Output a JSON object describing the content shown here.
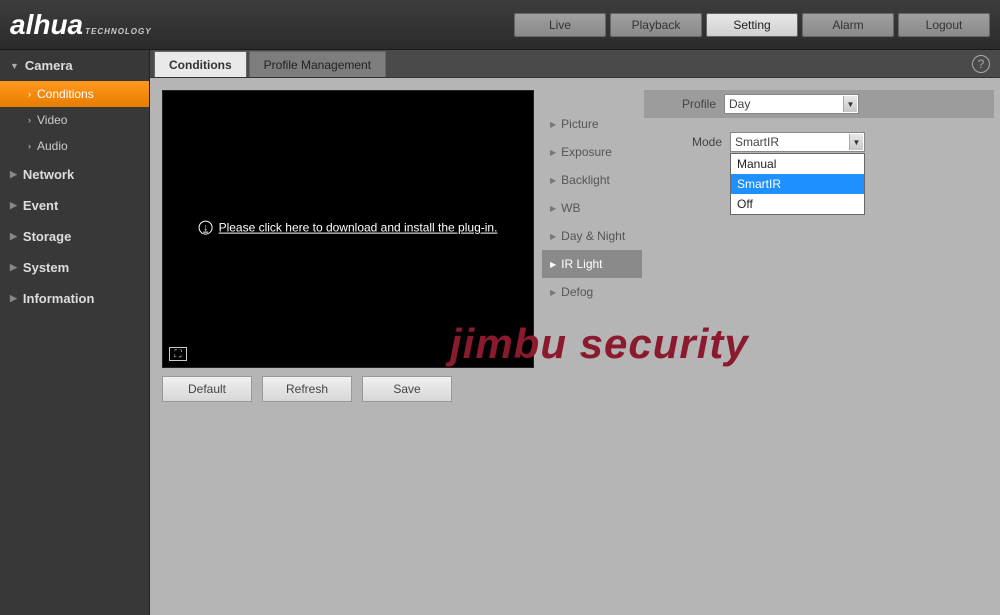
{
  "brand": {
    "name": "alhua",
    "sub": "TECHNOLOGY"
  },
  "top_tabs": {
    "live": "Live",
    "playback": "Playback",
    "setting": "Setting",
    "alarm": "Alarm",
    "logout": "Logout"
  },
  "sidebar": {
    "camera": {
      "label": "Camera",
      "items": {
        "conditions": "Conditions",
        "video": "Video",
        "audio": "Audio"
      }
    },
    "network": "Network",
    "event": "Event",
    "storage": "Storage",
    "system": "System",
    "information": "Information"
  },
  "sub_tabs": {
    "conditions": "Conditions",
    "profile_mgmt": "Profile Management"
  },
  "preview": {
    "plugin_msg": "Please click here to download and install the plug-in."
  },
  "buttons": {
    "default": "Default",
    "refresh": "Refresh",
    "save": "Save"
  },
  "settings_nav": {
    "picture": "Picture",
    "exposure": "Exposure",
    "backlight": "Backlight",
    "wb": "WB",
    "daynight": "Day & Night",
    "irlight": "IR Light",
    "defog": "Defog"
  },
  "form": {
    "profile_label": "Profile",
    "profile_value": "Day",
    "mode_label": "Mode",
    "mode_value": "SmartIR",
    "mode_options": {
      "manual": "Manual",
      "smartir": "SmartIR",
      "off": "Off"
    }
  },
  "watermark": "jimbu security",
  "help": "?"
}
